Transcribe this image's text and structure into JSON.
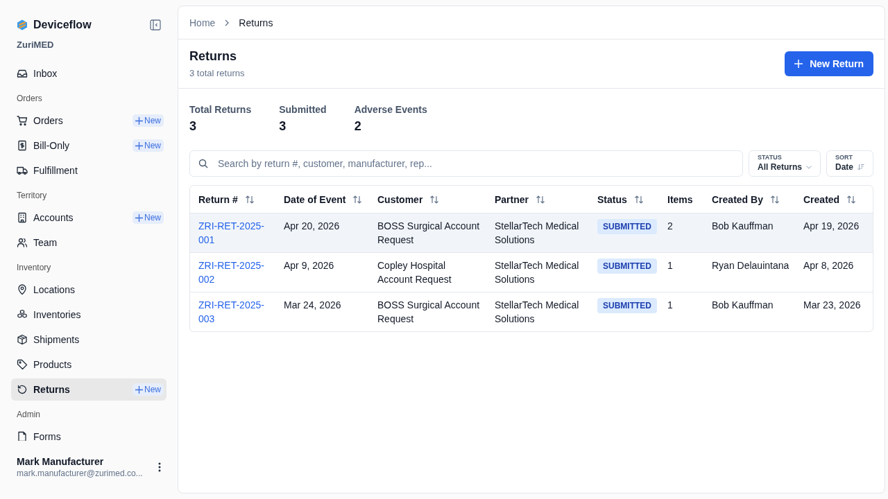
{
  "sidebar": {
    "brand": "Deviceflow",
    "org": "ZuriMED",
    "nav": [
      {
        "kind": "link",
        "label": "Inbox",
        "selected": false
      },
      {
        "kind": "section",
        "label": "Orders"
      },
      {
        "kind": "link",
        "label": "Orders",
        "selected": false,
        "badge": "New"
      },
      {
        "kind": "link",
        "label": "Bill-Only",
        "selected": false,
        "badge": "New"
      },
      {
        "kind": "link",
        "label": "Fulfillment",
        "selected": false
      },
      {
        "kind": "section",
        "label": "Territory"
      },
      {
        "kind": "link",
        "label": "Accounts",
        "selected": false,
        "badge": "New"
      },
      {
        "kind": "link",
        "label": "Team",
        "selected": false
      },
      {
        "kind": "section",
        "label": "Inventory"
      },
      {
        "kind": "link",
        "label": "Locations",
        "selected": false
      },
      {
        "kind": "link",
        "label": "Inventories",
        "selected": false
      },
      {
        "kind": "link",
        "label": "Shipments",
        "selected": false
      },
      {
        "kind": "link",
        "label": "Products",
        "selected": false
      },
      {
        "kind": "link",
        "label": "Returns",
        "selected": true,
        "badge": "New"
      },
      {
        "kind": "section",
        "label": "Admin"
      },
      {
        "kind": "link",
        "label": "Forms",
        "selected": false
      }
    ],
    "user": {
      "name": "Mark Manufacturer",
      "email": "mark.manufacturer@zurimed.co..."
    }
  },
  "breadcrumb": [
    "Home",
    "Returns"
  ],
  "header": {
    "title": "Returns",
    "subtitle": "3 total returns",
    "button": "New Return"
  },
  "stats": [
    {
      "label": "Total Returns",
      "value": "3"
    },
    {
      "label": "Submitted",
      "value": "3"
    },
    {
      "label": "Adverse Events",
      "value": "2"
    }
  ],
  "search": {
    "placeholder": "Search by return #, customer, manufacturer, rep..."
  },
  "filters": [
    {
      "label": "STATUS",
      "value": "All Returns",
      "kind": "dropdown"
    },
    {
      "label": "SORT",
      "value": "Date",
      "kind": "sort"
    }
  ],
  "table": {
    "columns": [
      {
        "label": "Return #",
        "sortable": true
      },
      {
        "label": "Date of Event",
        "sortable": true
      },
      {
        "label": "Customer",
        "sortable": true
      },
      {
        "label": "Partner",
        "sortable": true
      },
      {
        "label": "Status",
        "sortable": true
      },
      {
        "label": "Items",
        "sortable": false
      },
      {
        "label": "Created By",
        "sortable": true
      },
      {
        "label": "Created",
        "sortable": true
      }
    ],
    "rows": [
      {
        "selected": true,
        "cells": [
          "ZRI-RET-2025-001",
          "Apr 20, 2026",
          "BOSS Surgical Account Request",
          "StellarTech Medical Solutions",
          "SUBMITTED",
          "2",
          "Bob Kauffman",
          "Apr 19, 2026"
        ]
      },
      {
        "selected": false,
        "cells": [
          "ZRI-RET-2025-002",
          "Apr 9, 2026",
          "Copley Hospital Account Request",
          "StellarTech Medical Solutions",
          "SUBMITTED",
          "1",
          "Ryan Delauintana",
          "Apr 8, 2026"
        ]
      },
      {
        "selected": false,
        "cells": [
          "ZRI-RET-2025-003",
          "Mar 24, 2026",
          "BOSS Surgical Account Request",
          "StellarTech Medical Solutions",
          "SUBMITTED",
          "1",
          "Bob Kauffman",
          "Mar 23, 2026"
        ]
      }
    ]
  }
}
